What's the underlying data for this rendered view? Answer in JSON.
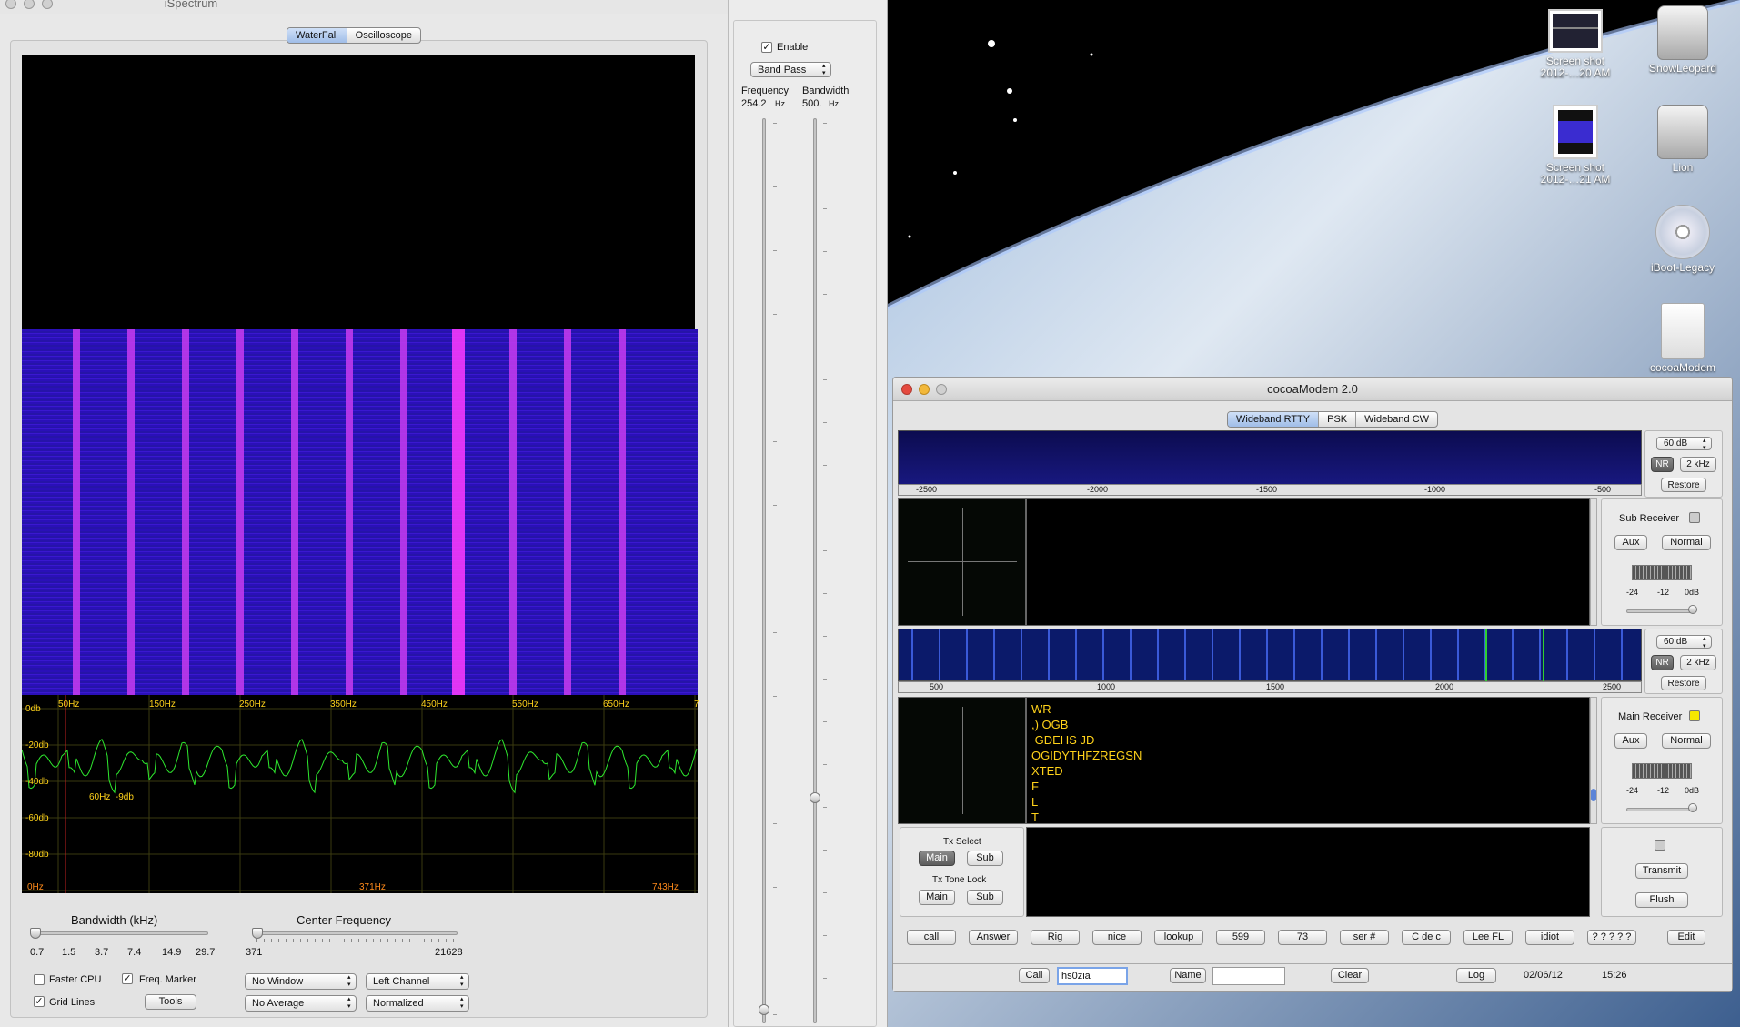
{
  "desktop": {
    "icons": [
      {
        "label": "Screen shot\n2012-…20 AM"
      },
      {
        "label": "SnowLeopard"
      },
      {
        "label": "Screen shot\n2012-…21 AM"
      },
      {
        "label": "Lion"
      },
      {
        "label": "iBoot-Legacy"
      },
      {
        "label": "cocoaModem"
      }
    ]
  },
  "ispectrum": {
    "title": "iSpectrum",
    "tabs": [
      "WaterFall",
      "Oscilloscope"
    ],
    "freq_labels": [
      "50Hz",
      "150Hz",
      "250Hz",
      "350Hz",
      "450Hz",
      "550Hz",
      "650Hz",
      "7"
    ],
    "db_labels": [
      "0db",
      "-20db",
      "-40db",
      "-60db",
      "-80db"
    ],
    "marker": "60Hz  -9db",
    "bottom_labels": [
      "0Hz",
      "371Hz",
      "743Hz"
    ],
    "bandwidth_title": "Bandwidth (kHz)",
    "bandwidth_ticks": [
      "0.7",
      "1.5",
      "3.7",
      "7.4",
      "14.9",
      "29.7"
    ],
    "center_title": "Center Frequency",
    "center_min": "371",
    "center_max": "21628",
    "faster_cpu": "Faster CPU",
    "freq_marker": "Freq. Marker",
    "grid_lines": "Grid Lines",
    "tools": "Tools",
    "window_select": "No Window",
    "channel_select": "Left Channel",
    "average_select": "No Average",
    "norm_select": "Normalized"
  },
  "filter": {
    "enable": "Enable",
    "mode": "Band Pass",
    "freq_label": "Frequency",
    "freq_value": "254.2",
    "freq_unit": "Hz.",
    "bw_label": "Bandwidth",
    "bw_value": "500.",
    "bw_unit": "Hz."
  },
  "modem": {
    "title": "cocoaModem 2.0",
    "tabs": [
      "Wideband RTTY",
      "PSK",
      "Wideband CW"
    ],
    "top_scale": [
      "-2500",
      "-2000",
      "-1500",
      "-1000",
      "-500"
    ],
    "db_select": "60 dB",
    "nr": "NR",
    "khz": "2 kHz",
    "restore": "Restore",
    "sub_receiver": "Sub Receiver",
    "main_receiver": "Main Receiver",
    "aux": "Aux",
    "normal": "Normal",
    "meter_labels": [
      "-24",
      "-12",
      "0dB"
    ],
    "mid_scale": [
      "500",
      "1000",
      "1500",
      "2000",
      "2500"
    ],
    "rx_lines": [
      "WR",
      ",) OGB",
      " GDEHS JD",
      "OGIDYTHFZREGSN",
      "XTED",
      "F",
      "L",
      "T"
    ],
    "tx_select": "Tx Select",
    "tx_tone_lock": "Tx Tone Lock",
    "main": "Main",
    "sub": "Sub",
    "transmit": "Transmit",
    "flush": "Flush",
    "macros": [
      "call",
      "Answer",
      "Rig",
      "nice",
      "lookup",
      "599",
      "73",
      "ser #",
      "C de c",
      "Lee FL",
      "idiot",
      "? ? ? ? ?"
    ],
    "edit": "Edit",
    "call_btn": "Call",
    "call_value": "hs0zia",
    "name_btn": "Name",
    "name_value": "",
    "clear": "Clear",
    "log": "Log",
    "date": "02/06/12",
    "time": "15:26"
  }
}
